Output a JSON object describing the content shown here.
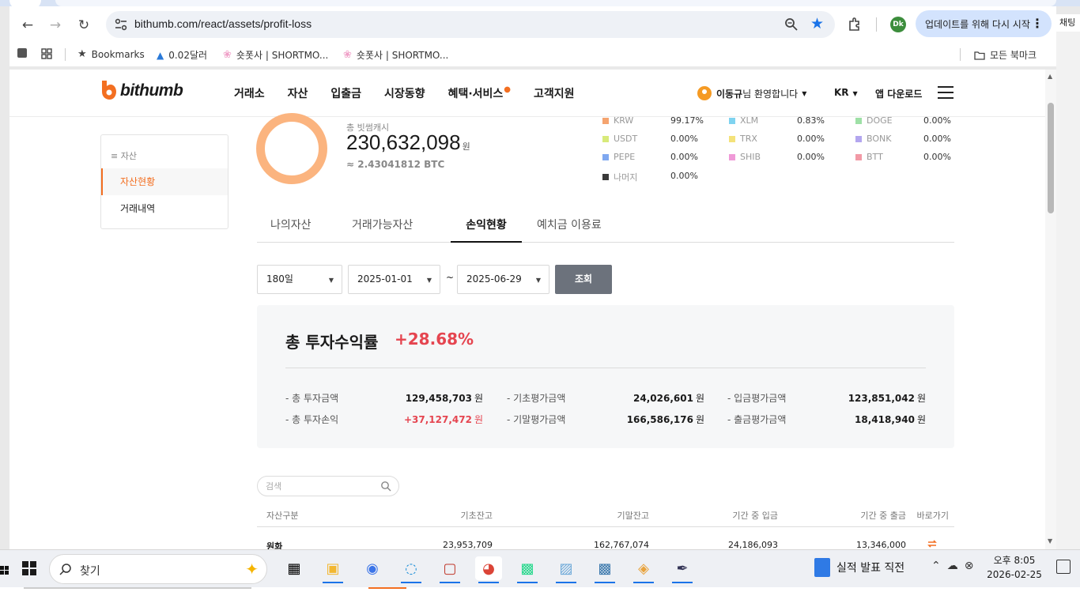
{
  "browser": {
    "url": "bithumb.com/react/assets/profit-loss",
    "update_button": "업데이트를 위해 다시 시작",
    "profile_initials": "Dk",
    "side_chip": "채팅",
    "bookmarks": [
      {
        "label": "Bookmarks",
        "icon": "star-icon"
      },
      {
        "label": "0.02달러",
        "icon": "drop-icon"
      },
      {
        "label": "숏폿사 | SHORTMO...",
        "icon": "flower-icon"
      },
      {
        "label": "숏폿사 | SHORTMO...",
        "icon": "flower-icon"
      }
    ],
    "all_bookmarks": "모든 북마크"
  },
  "header": {
    "logo": "bithumb",
    "nav": [
      "거래소",
      "자산",
      "입출금",
      "시장동향",
      "혜택·서비스",
      "고객지원"
    ],
    "user_name": "이동규",
    "user_greeting": "님 환영합니다",
    "lang": "KR",
    "app_download": "앱 다운로드"
  },
  "side_menu": {
    "heading": "자산",
    "items": [
      "자산현황",
      "거래내역"
    ]
  },
  "summary": {
    "label": "총 빗썸캐시",
    "amount": "230,632,098",
    "unit": "원",
    "btc": "≈ 2.43041812 BTC",
    "legend": [
      {
        "name": "KRW",
        "pct": "99.17%",
        "color": "#f5a46f"
      },
      {
        "name": "XLM",
        "pct": "0.83%",
        "color": "#7fd3f0"
      },
      {
        "name": "DOGE",
        "pct": "0.00%",
        "color": "#9ee0a6"
      },
      {
        "name": "USDT",
        "pct": "0.00%",
        "color": "#d8ea7a"
      },
      {
        "name": "TRX",
        "pct": "0.00%",
        "color": "#f4e27a"
      },
      {
        "name": "BONK",
        "pct": "0.00%",
        "color": "#b3a6ef"
      },
      {
        "name": "PEPE",
        "pct": "0.00%",
        "color": "#7fa8f0"
      },
      {
        "name": "SHIB",
        "pct": "0.00%",
        "color": "#f09ad8"
      },
      {
        "name": "BTT",
        "pct": "0.00%",
        "color": "#f29aa6"
      },
      {
        "name": "나머지",
        "pct": "0.00%",
        "color": "#3a3a3a"
      }
    ]
  },
  "tabs": [
    "나의자산",
    "거래가능자산",
    "손익현황",
    "예치금 이용료"
  ],
  "filters": {
    "period": "180일",
    "start_date": "2025-01-01",
    "tilde": "~",
    "end_date": "2025-06-29",
    "query": "조회"
  },
  "roi": {
    "title": "총 투자수익률",
    "rate": "+28.68%",
    "unit": "원",
    "rows": [
      {
        "label": "- 총 투자금액",
        "value": "129,458,703"
      },
      {
        "label": "- 총 투자손익",
        "value": "+37,127,472"
      },
      {
        "label": "- 기초평가금액",
        "value": "24,026,601"
      },
      {
        "label": "- 기말평가금액",
        "value": "166,586,176"
      },
      {
        "label": "- 입금평가금액",
        "value": "123,851,042"
      },
      {
        "label": "- 출금평가금액",
        "value": "18,418,940"
      }
    ]
  },
  "table": {
    "search_placeholder": "검색",
    "headers": [
      "자산구분",
      "기초잔고",
      "기말잔고",
      "기간 중 입금",
      "기간 중 출금",
      "바로가기"
    ],
    "rows": [
      [
        "원화",
        "23,953,709",
        "162,767,074",
        "24,186,093",
        "13,346,000"
      ]
    ]
  },
  "taskbar": {
    "search_placeholder": "찾기",
    "news": "실적 발표 직전",
    "time": "오후 8:05",
    "date": "2026-02-25"
  }
}
